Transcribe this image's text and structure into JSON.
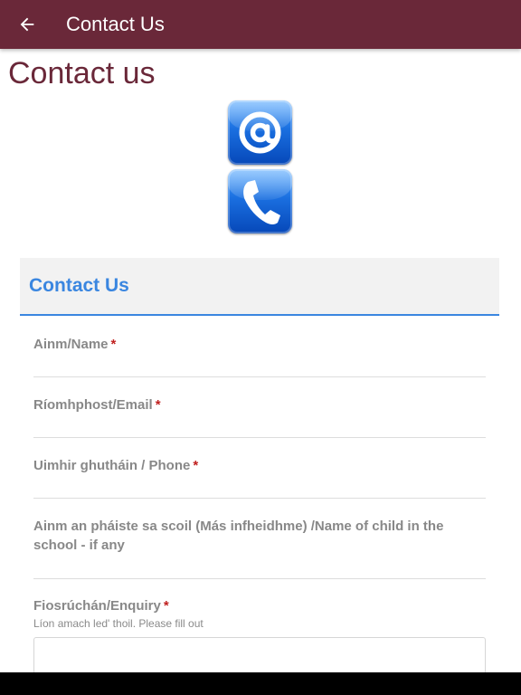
{
  "app_bar": {
    "title": "Contact Us",
    "color": "#6a2839"
  },
  "page": {
    "heading": "Contact us"
  },
  "icons": {
    "email": "at-sign-icon",
    "phone": "phone-handset-icon"
  },
  "form": {
    "title": "Contact Us",
    "accent_color": "#3a86e0",
    "required_marker": "*",
    "fields": [
      {
        "label": "Ainm/Name",
        "required": true
      },
      {
        "label": "Ríomhphost/Email",
        "required": true
      },
      {
        "label": "Uimhir ghutháin / Phone",
        "required": true
      },
      {
        "label": "Ainm an pháiste sa scoil (Más infheidhme) /Name of child in the school - if any",
        "required": false
      },
      {
        "label": "Fiosrúchán/Enquiry",
        "required": true,
        "help": "Líon amach led' thoil. Please fill out"
      }
    ]
  }
}
